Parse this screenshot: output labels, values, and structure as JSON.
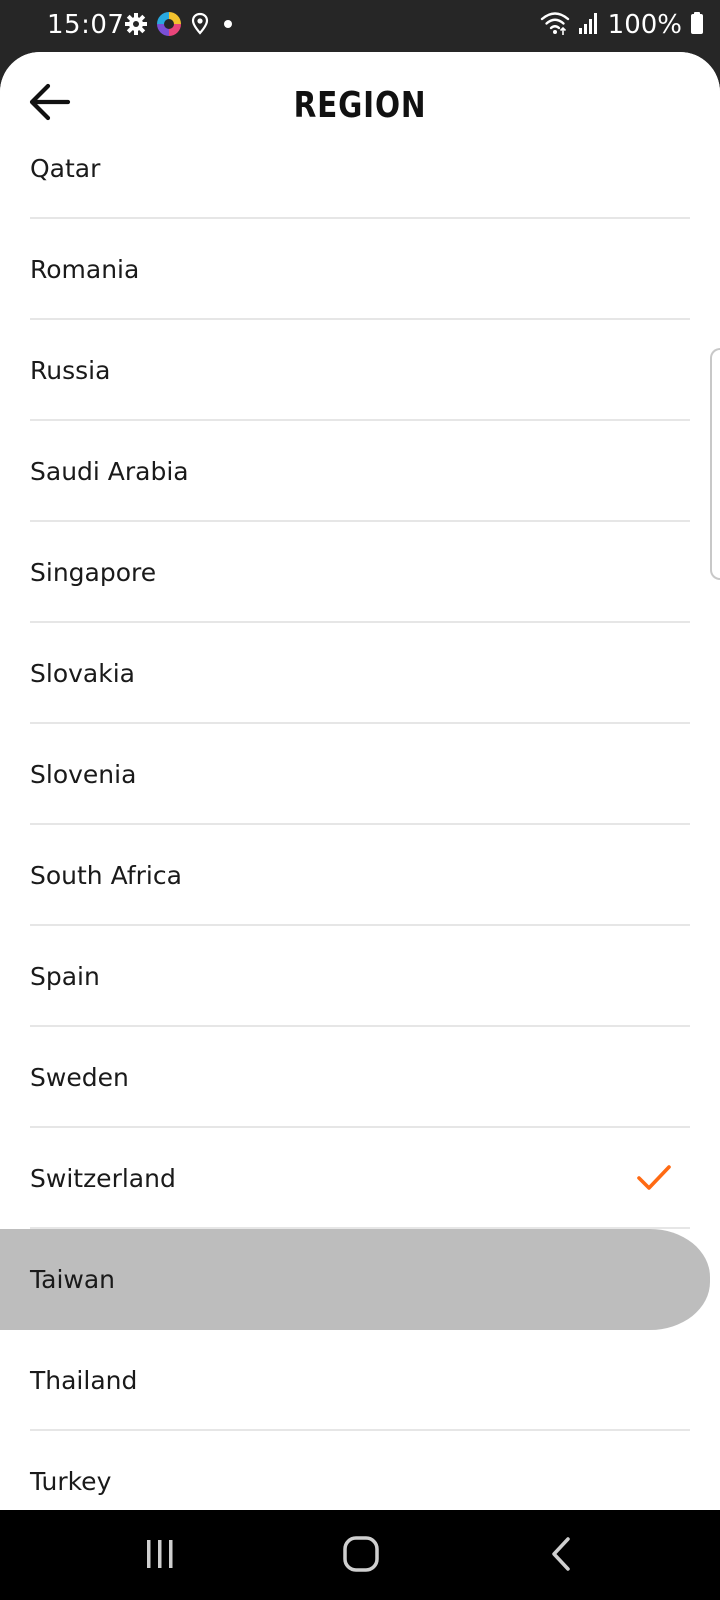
{
  "status_bar": {
    "time": "15:07",
    "battery": "100%",
    "icons_left": [
      "gear-icon",
      "app-badge-icon",
      "location-pin-icon",
      "dot-icon"
    ],
    "icons_right": [
      "wifi-icon",
      "signal-icon",
      "battery-icon"
    ]
  },
  "header": {
    "title": "REGION",
    "back_icon": "arrow-left-icon"
  },
  "regions": [
    {
      "name": "Qatar",
      "selected": false,
      "pressed": false
    },
    {
      "name": "Romania",
      "selected": false,
      "pressed": false
    },
    {
      "name": "Russia",
      "selected": false,
      "pressed": false
    },
    {
      "name": "Saudi Arabia",
      "selected": false,
      "pressed": false
    },
    {
      "name": "Singapore",
      "selected": false,
      "pressed": false
    },
    {
      "name": "Slovakia",
      "selected": false,
      "pressed": false
    },
    {
      "name": "Slovenia",
      "selected": false,
      "pressed": false
    },
    {
      "name": "South Africa",
      "selected": false,
      "pressed": false
    },
    {
      "name": "Spain",
      "selected": false,
      "pressed": false
    },
    {
      "name": "Sweden",
      "selected": false,
      "pressed": false
    },
    {
      "name": "Switzerland",
      "selected": true,
      "pressed": false
    },
    {
      "name": "Taiwan",
      "selected": false,
      "pressed": true
    },
    {
      "name": "Thailand",
      "selected": false,
      "pressed": false
    },
    {
      "name": "Turkey",
      "selected": false,
      "pressed": false
    }
  ],
  "colors": {
    "accent": "#ff6a13",
    "pressed_bg": "#bdbdbd",
    "status_bar_bg": "#262626",
    "nav_bar_bg": "#000000"
  },
  "nav_bar": {
    "buttons": [
      "recent-apps-icon",
      "home-icon",
      "back-icon"
    ]
  }
}
